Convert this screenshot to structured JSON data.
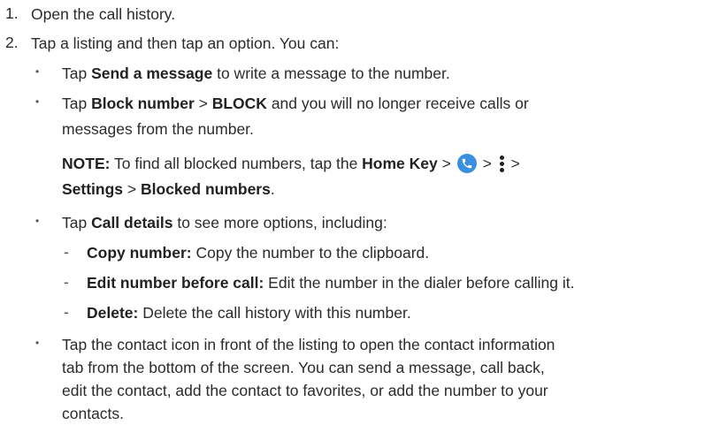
{
  "steps": [
    {
      "num": "1.",
      "text": "Open the call history."
    },
    {
      "num": "2.",
      "text": "Tap a listing and then tap an option. You can:"
    }
  ],
  "options": {
    "send_message": {
      "pre": "Tap ",
      "bold": "Send a message",
      "post": " to write a message to the number."
    },
    "block_number": {
      "pre": "Tap ",
      "bold1": "Block number",
      "mid": " > ",
      "bold2": "BLOCK",
      "post": " and you will no longer receive calls or",
      "line2": "messages from the number."
    },
    "note": {
      "label": "NOTE:",
      "pre": " To find all blocked numbers, tap the ",
      "home_key": "Home Key",
      "sep1": " > ",
      "sep2": " > ",
      "sep3": " >",
      "settings": "Settings",
      "sep4": " > ",
      "blocked": "Blocked numbers",
      "end": ".",
      "icons": [
        "phone-icon",
        "more-options-icon"
      ]
    },
    "call_details": {
      "pre": "Tap ",
      "bold": "Call details",
      "post": " to see more options, including:",
      "items": [
        {
          "bold": "Copy number:",
          "text": " Copy the number to the clipboard."
        },
        {
          "bold": "Edit number before call:",
          "text": " Edit the number in the dialer before calling it."
        },
        {
          "bold": "Delete:",
          "text": " Delete the call history with this number."
        }
      ]
    },
    "contact_icon": {
      "lines": [
        "Tap the contact icon in front of the listing to open the contact information",
        "tab from the bottom of the screen. You can send a message, call back,",
        "edit the contact, add the contact to favorites, or add the number to your",
        "contacts."
      ]
    }
  },
  "colors": {
    "text": "#2b2b2b",
    "icon_blue": "#3a8fe0"
  }
}
